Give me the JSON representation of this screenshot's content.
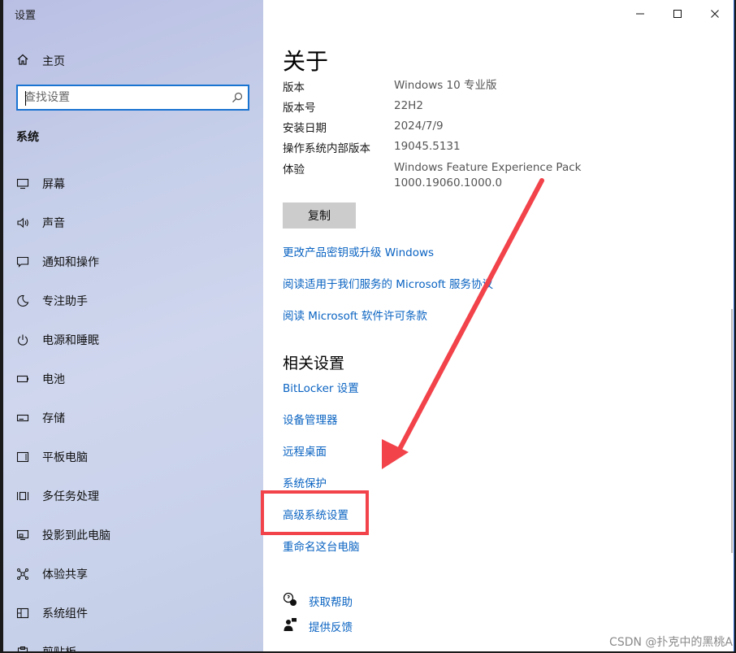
{
  "window": {
    "title": "设置"
  },
  "sidebar": {
    "home_label": "主页",
    "search_placeholder": "查找设置",
    "section_label": "系统",
    "items": [
      {
        "label": "屏幕",
        "icon": "monitor-icon"
      },
      {
        "label": "声音",
        "icon": "speaker-icon"
      },
      {
        "label": "通知和操作",
        "icon": "notification-icon"
      },
      {
        "label": "专注助手",
        "icon": "moon-icon"
      },
      {
        "label": "电源和睡眠",
        "icon": "power-icon"
      },
      {
        "label": "电池",
        "icon": "battery-icon"
      },
      {
        "label": "存储",
        "icon": "storage-icon"
      },
      {
        "label": "平板电脑",
        "icon": "tablet-icon"
      },
      {
        "label": "多任务处理",
        "icon": "multitask-icon"
      },
      {
        "label": "投影到此电脑",
        "icon": "project-icon"
      },
      {
        "label": "体验共享",
        "icon": "share-icon"
      },
      {
        "label": "系统组件",
        "icon": "components-icon"
      },
      {
        "label": "剪贴板",
        "icon": "clipboard-icon"
      }
    ]
  },
  "content": {
    "title": "关于",
    "specs": [
      {
        "label": "版本",
        "value": "Windows 10 专业版"
      },
      {
        "label": "版本号",
        "value": "22H2"
      },
      {
        "label": "安装日期",
        "value": "2024/7/9"
      },
      {
        "label": "操作系统内部版本",
        "value": "19045.5131"
      },
      {
        "label": "体验",
        "value": "Windows Feature Experience Pack",
        "value2": "1000.19060.1000.0"
      }
    ],
    "copy_label": "复制",
    "links": [
      "更改产品密钥或升级 Windows",
      "阅读适用于我们服务的 Microsoft 服务协议",
      "阅读 Microsoft 软件许可条款"
    ],
    "related_title": "相关设置",
    "related_links": [
      "BitLocker 设置",
      "设备管理器",
      "远程桌面",
      "系统保护",
      "高级系统设置",
      "重命名这台电脑"
    ],
    "help": {
      "get_help": "获取帮助",
      "feedback": "提供反馈"
    }
  },
  "watermark": "CSDN @扑克中的黑桃A",
  "colors": {
    "accent": "#0a63c2",
    "highlight": "#f2424a",
    "search_border": "#1973d1"
  }
}
